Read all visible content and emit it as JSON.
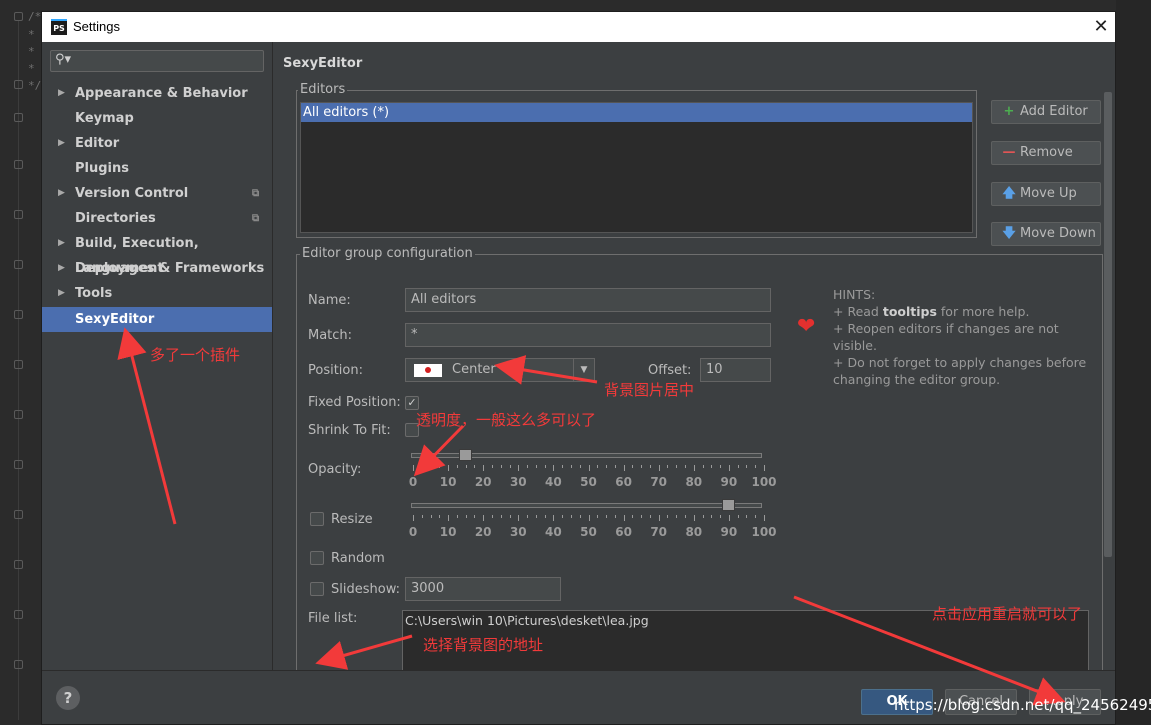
{
  "background": {
    "code_lines": [
      "/*",
      "*",
      "*",
      "*",
      "*/"
    ]
  },
  "window": {
    "title": "Settings",
    "logo_text": "PS",
    "close_glyph": "✕"
  },
  "sidebar": {
    "search_placeholder": "",
    "items": [
      {
        "label": "Appearance & Behavior",
        "arrow": "▶"
      },
      {
        "label": "Keymap",
        "arrow": ""
      },
      {
        "label": "Editor",
        "arrow": "▶"
      },
      {
        "label": "Plugins",
        "arrow": ""
      },
      {
        "label": "Version Control",
        "arrow": "▶"
      },
      {
        "label": "Directories",
        "arrow": ""
      },
      {
        "label": "Build, Execution, Deployment",
        "arrow": "▶"
      },
      {
        "label": "Languages & Frameworks",
        "arrow": "▶"
      },
      {
        "label": "Tools",
        "arrow": "▶"
      },
      {
        "label": "SexyEditor",
        "arrow": ""
      }
    ]
  },
  "main": {
    "section_title": "SexyEditor",
    "editors_legend": "Editors",
    "editors_list": [
      "All editors (*)"
    ],
    "buttons": {
      "add": "Add Editor",
      "remove": "Remove",
      "move_up": "Move Up",
      "move_down": "Move Down"
    },
    "group_legend": "Editor group configuration",
    "fields": {
      "name_label": "Name:",
      "name_value": "All editors",
      "match_label": "Match:",
      "match_value": "*",
      "position_label": "Position:",
      "position_value": "Center",
      "offset_label": "Offset:",
      "offset_value": "10",
      "fixed_label": "Fixed Position:",
      "fixed_checked": "✓",
      "shrink_label": "Shrink To Fit:",
      "opacity_label": "Opacity:",
      "opacity_value": 15,
      "resize_label": "Resize",
      "resize_value": 90,
      "random_label": "Random",
      "slideshow_label": "Slideshow:",
      "slideshow_value": "3000",
      "filelist_label": "File list:",
      "filelist_value": "C:\\Users\\win 10\\Pictures\\desket\\lea.jpg"
    },
    "slider_ticks": [
      "0",
      "10",
      "20",
      "30",
      "40",
      "50",
      "60",
      "70",
      "80",
      "90",
      "100"
    ],
    "hints": {
      "title": "HINTS:",
      "line1_pre": "+ Read ",
      "line1_bold": "tooltips",
      "line1_post": " for more help.",
      "line2": "+ Reopen editors if changes are not visible.",
      "line3": "+ Do not forget to apply changes before",
      "line4": "changing the editor group."
    }
  },
  "footer": {
    "help": "?",
    "ok": "OK",
    "cancel": "Cancel",
    "apply": "Apply"
  },
  "annotations": {
    "plugin": "多了一个插件",
    "center": "背景图片居中",
    "opacity": "透明度，一般这么多可以了",
    "path": "选择背景图的地址",
    "apply": "点击应用重启就可以了"
  },
  "watermark": "https://blog.csdn.net/qq_24562495",
  "colors": {
    "selection": "#4b6eaf",
    "annotation": "#f23a3a",
    "heart": "#e3302f"
  }
}
